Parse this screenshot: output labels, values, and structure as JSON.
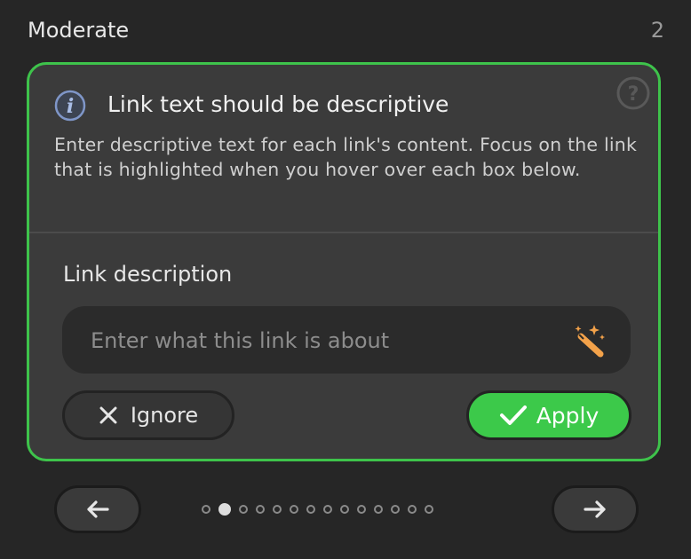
{
  "header": {
    "label": "Moderate",
    "count": "2"
  },
  "card": {
    "title": "Link text should be descriptive",
    "body": "Enter descriptive text for each link's content. Focus on the link that is highlighted when you hover over each box below.",
    "field_label": "Link description",
    "input": {
      "value": "",
      "placeholder": "Enter what this link is about"
    },
    "ignore_label": "Ignore",
    "apply_label": "Apply"
  },
  "pager": {
    "total": 14,
    "active_index": 1
  },
  "colors": {
    "accent": "#3ec34b",
    "card_bg": "#3b3b3b",
    "page_bg": "#262626",
    "info_icon": "#7f96c8",
    "wand_icon": "#f3a24a"
  },
  "icons": {
    "info": "info-icon",
    "help": "help-icon",
    "wand": "magic-wand-icon",
    "ignore": "close-icon",
    "apply": "checkmark-icon",
    "prev": "arrow-left-icon",
    "next": "arrow-right-icon"
  }
}
